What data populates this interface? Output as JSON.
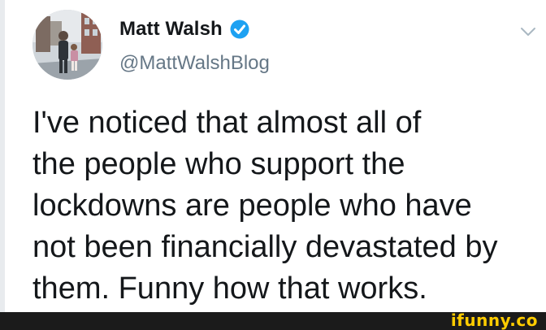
{
  "author": {
    "name": "Matt Walsh",
    "handle": "@MattWalshBlog",
    "verified": true,
    "avatar": "profile-photo"
  },
  "tweet": {
    "lines": [
      "I've noticed that almost all of",
      "the people who support the",
      "lockdowns are people who have",
      "not been financially devastated by",
      "them. Funny how that works."
    ]
  },
  "watermark": {
    "text": "ifunny.co"
  },
  "colors": {
    "verified_blue": "#1da1f2",
    "text_primary": "#14171a",
    "text_secondary": "#657786",
    "watermark_yellow": "#ffcc00",
    "watermark_bar": "#1b1b1b"
  },
  "icons": {
    "verified": "verified-badge-icon",
    "menu": "chevron-down-icon"
  }
}
